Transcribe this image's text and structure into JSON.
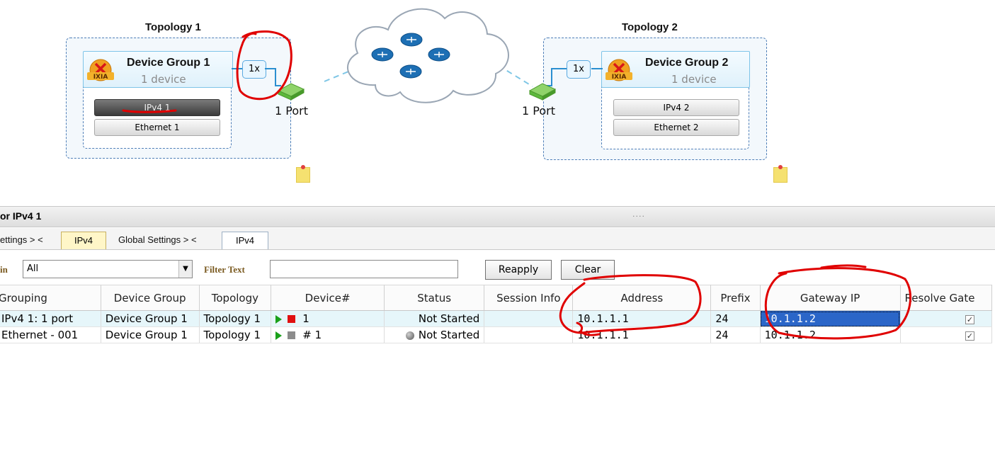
{
  "topology1": {
    "title": "Topology 1",
    "device_group": {
      "name": "Device Group 1",
      "count": "1 device",
      "multiplier": "1x"
    },
    "stacks": [
      "IPv4 1",
      "Ethernet 1"
    ],
    "port": "1 Port"
  },
  "topology2": {
    "title": "Topology 2",
    "device_group": {
      "name": "Device Group 2",
      "count": "1 device",
      "multiplier": "1x"
    },
    "stacks": [
      "IPv4 2",
      "Ethernet 2"
    ],
    "port": "1 Port"
  },
  "logo_text": "IXIA",
  "panel": {
    "title": "or IPv4 1",
    "grip": "...."
  },
  "tabs": {
    "crumb1": "ettings > <",
    "tab1": "IPv4",
    "crumb2": "Global Settings > <",
    "tab2": "IPv4"
  },
  "filter": {
    "in_label": "in",
    "select_value": "All",
    "filter_text_label": "Filter Text",
    "filter_text_value": "",
    "reapply_label": "Reapply",
    "clear_label": "Clear"
  },
  "grid": {
    "columns": [
      "Grouping",
      "Device Group",
      "Topology",
      "Device#",
      "Status",
      "Session Info",
      "Address",
      "Prefix",
      "Gateway IP",
      "Resolve Gate"
    ],
    "rows": [
      {
        "grouping": "IPv4 1: 1 port",
        "device_group": "Device Group 1",
        "topology": "Topology 1",
        "device_num": "1",
        "status": "Not Started",
        "session_info": "",
        "address": "10.1.1.1",
        "prefix": "24",
        "gateway_ip": "10.1.1.2",
        "resolve_gateway": true
      },
      {
        "grouping": "Ethernet - 001",
        "device_group": "Device Group 1",
        "topology": "Topology 1",
        "device_num": "# 1",
        "status": "Not Started",
        "session_info": "",
        "address": "10.1.1.1",
        "prefix": "24",
        "gateway_ip": "10.1.1.2",
        "resolve_gateway": true
      }
    ]
  },
  "colors": {
    "accent_blue": "#2b66c8",
    "annotation_red": "#e00000",
    "status_red": "#e01010",
    "status_gray": "#8c8c8c"
  }
}
